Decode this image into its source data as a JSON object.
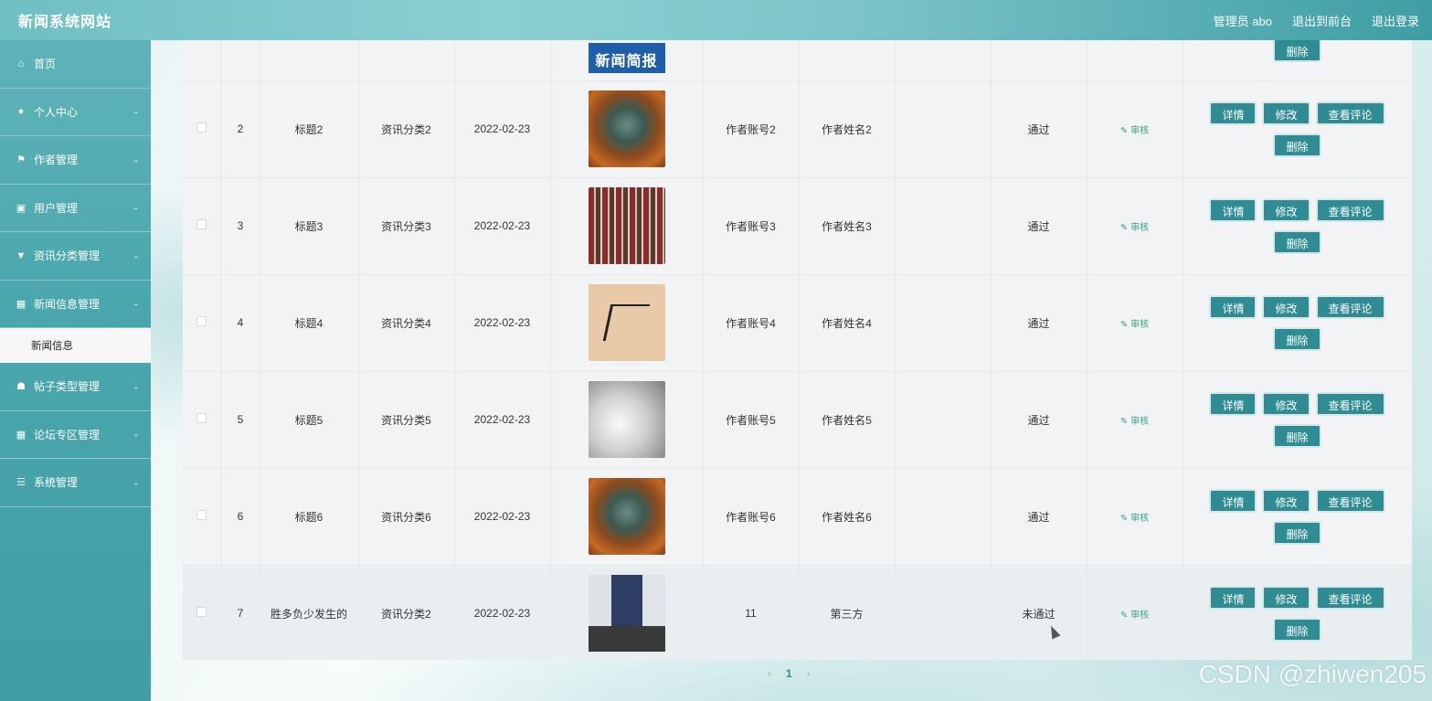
{
  "header": {
    "brand": "新闻系统网站",
    "admin_label": "管理员 abo",
    "to_front": "退出到前台",
    "logout": "退出登录"
  },
  "sidebar": {
    "items": [
      {
        "label": "首页",
        "icon": "home-icon",
        "has_submenu": false
      },
      {
        "label": "个人中心",
        "icon": "user-icon",
        "has_submenu": true
      },
      {
        "label": "作者管理",
        "icon": "flag-icon",
        "has_submenu": true
      },
      {
        "label": "用户管理",
        "icon": "clipboard-icon",
        "has_submenu": true
      },
      {
        "label": "资讯分类管理",
        "icon": "filter-icon",
        "has_submenu": true
      },
      {
        "label": "新闻信息管理",
        "icon": "grid-icon",
        "has_submenu": true
      },
      {
        "label": "帖子类型管理",
        "icon": "thumbs-up-icon",
        "has_submenu": true
      },
      {
        "label": "论坛专区管理",
        "icon": "grid-icon",
        "has_submenu": true
      },
      {
        "label": "系统管理",
        "icon": "sliders-icon",
        "has_submenu": true
      }
    ],
    "active_submenu": "新闻信息"
  },
  "table": {
    "top_partial": {
      "image_text": "新闻简报"
    },
    "rows": [
      {
        "id": "2",
        "title": "标题2",
        "category": "资讯分类2",
        "date": "2022-02-23",
        "image": "statue",
        "author_account": "作者账号2",
        "author_name": "作者姓名2",
        "status": "通过"
      },
      {
        "id": "3",
        "title": "标题3",
        "category": "资讯分类3",
        "date": "2022-02-23",
        "image": "shelves",
        "author_account": "作者账号3",
        "author_name": "作者姓名3",
        "status": "通过"
      },
      {
        "id": "4",
        "title": "标题4",
        "category": "资讯分类4",
        "date": "2022-02-23",
        "image": "calligraphy",
        "author_account": "作者账号4",
        "author_name": "作者姓名4",
        "status": "通过"
      },
      {
        "id": "5",
        "title": "标题5",
        "category": "资讯分类5",
        "date": "2022-02-23",
        "image": "cartoon",
        "author_account": "作者账号5",
        "author_name": "作者姓名5",
        "status": "通过"
      },
      {
        "id": "6",
        "title": "标题6",
        "category": "资讯分类6",
        "date": "2022-02-23",
        "image": "statue",
        "author_account": "作者账号6",
        "author_name": "作者姓名6",
        "status": "通过"
      },
      {
        "id": "7",
        "title": "胜多负少发生的",
        "category": "资讯分类2",
        "date": "2022-02-23",
        "image": "room",
        "author_account": "11",
        "author_name": "第三方",
        "status": "未通过"
      }
    ],
    "actions": {
      "audit": "审核",
      "detail": "详情",
      "edit": "修改",
      "comments": "查看评论",
      "delete": "删除"
    }
  },
  "pager": {
    "prev": "‹",
    "current": "1",
    "next": "›"
  },
  "watermark": "CSDN @zhiwen205"
}
